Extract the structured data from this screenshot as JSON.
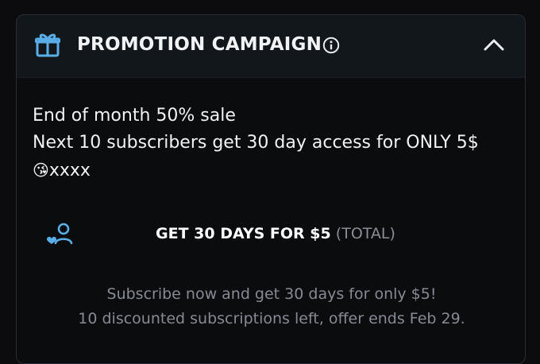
{
  "header": {
    "title": "PROMOTION CAMPAIGN",
    "icon": "gift-icon",
    "info_icon": "info-icon",
    "toggle_icon": "chevron-up-icon"
  },
  "promo": {
    "line1": "End of month 50% sale",
    "line2": "Next 10 subscribers get 30 day access for ONLY 5$",
    "line3_emoji": "😘",
    "line3_text": "xxxx"
  },
  "offer": {
    "icon": "subscriber-icon",
    "label": "GET 30 DAYS FOR $5",
    "suffix": "(TOTAL)"
  },
  "description": {
    "line1": "Subscribe now and get 30 days for only $5!",
    "line2": "10 discounted subscriptions left, offer ends Feb 29."
  },
  "colors": {
    "accent": "#5aaee8",
    "background": "#0b0c0e",
    "header_background": "#12171c",
    "muted_text": "#868a92"
  }
}
